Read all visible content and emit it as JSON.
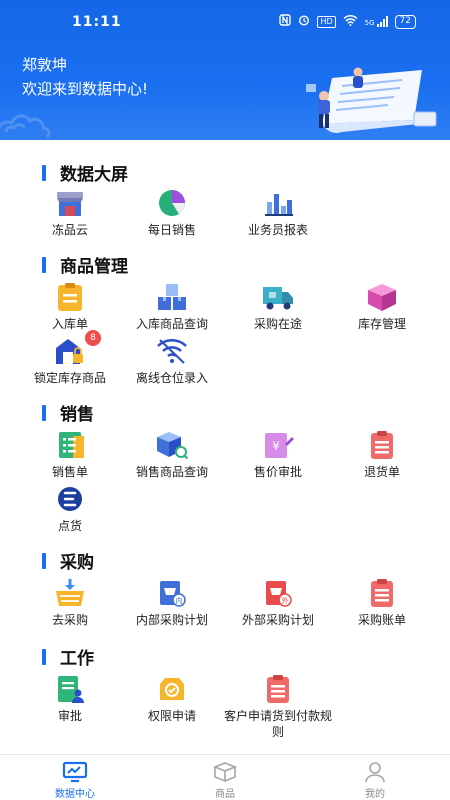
{
  "status_bar": {
    "time": "11:11",
    "net_tag": "HD",
    "net_type": "5G",
    "battery": "72"
  },
  "header": {
    "user_name": "郑敦坤",
    "welcome": "欢迎来到数据中心!"
  },
  "sections": {
    "dashboard": {
      "title": "数据大屏",
      "items": [
        {
          "label": "冻品云",
          "icon": "store-icon"
        },
        {
          "label": "每日销售",
          "icon": "pie-chart-icon"
        },
        {
          "label": "业务员报表",
          "icon": "bar-chart-icon"
        }
      ]
    },
    "goods": {
      "title": "商品管理",
      "items": [
        {
          "label": "入库单",
          "icon": "clipboard-icon"
        },
        {
          "label": "入库商品查询",
          "icon": "boxes-icon"
        },
        {
          "label": "采购在途",
          "icon": "truck-icon"
        },
        {
          "label": "库存管理",
          "icon": "cube-icon"
        },
        {
          "label": "锁定库存商品",
          "icon": "warehouse-lock-icon",
          "badge": "8"
        },
        {
          "label": "离线仓位录入",
          "icon": "wifi-off-icon"
        }
      ]
    },
    "sales": {
      "title": "销售",
      "items": [
        {
          "label": "销售单",
          "icon": "sales-list-icon"
        },
        {
          "label": "销售商品查询",
          "icon": "box-search-icon"
        },
        {
          "label": "售价审批",
          "icon": "price-edit-icon"
        },
        {
          "label": "退货单",
          "icon": "return-list-icon"
        },
        {
          "label": "点货",
          "icon": "count-goods-icon"
        }
      ]
    },
    "purchase": {
      "title": "采购",
      "items": [
        {
          "label": "去采购",
          "icon": "basket-icon"
        },
        {
          "label": "内部采购计划",
          "icon": "internal-plan-icon",
          "tag": "内"
        },
        {
          "label": "外部采购计划",
          "icon": "external-plan-icon",
          "tag": "外"
        },
        {
          "label": "采购账单",
          "icon": "purchase-bill-icon"
        }
      ]
    },
    "work": {
      "title": "工作",
      "items": [
        {
          "label": "审批",
          "icon": "approval-icon"
        },
        {
          "label": "权限申请",
          "icon": "permission-icon"
        },
        {
          "label": "客户申请货到付款规则",
          "icon": "cod-rule-icon"
        }
      ]
    }
  },
  "tabbar": {
    "items": [
      {
        "label": "数据中心",
        "icon": "monitor-icon",
        "active": true
      },
      {
        "label": "商品",
        "icon": "box-icon",
        "active": false
      },
      {
        "label": "我的",
        "icon": "user-icon",
        "active": false
      }
    ]
  },
  "colors": {
    "primary": "#1a6ff0",
    "badge": "#f04d4d",
    "yellow": "#f7b52c",
    "red": "#f06a6a",
    "purple": "#9b4de0",
    "green": "#2fb57a"
  }
}
